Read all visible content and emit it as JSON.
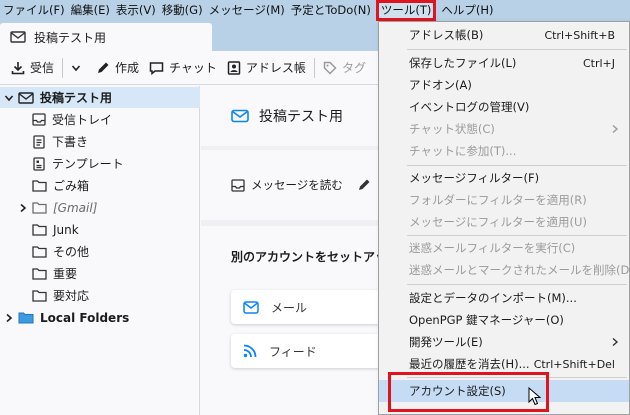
{
  "menubar": {
    "items": [
      "ファイル(F)",
      "編集(E)",
      "表示(V)",
      "移動(G)",
      "メッセージ(M)",
      "予定とToDo(N)",
      "ツール(T)",
      "ヘルプ(H)"
    ],
    "active": "ツール(T)"
  },
  "tab": {
    "title": "投稿テスト用"
  },
  "toolbar": {
    "receive": "受信",
    "compose": "作成",
    "chat": "チャット",
    "addressbook": "アドレス帳",
    "tag": "タグ"
  },
  "folders": {
    "account": "投稿テスト用",
    "items": [
      "受信トレイ",
      "下書き",
      "テンプレート",
      "ごみ箱",
      "[Gmail]",
      "Junk",
      "その他",
      "重要",
      "要対応"
    ],
    "local": "Local Folders"
  },
  "main": {
    "account_title": "投稿テスト用",
    "read_messages": "メッセージを読む",
    "setup_title": "別のアカウントをセットアップ",
    "mail": "メール",
    "feed": "フィード"
  },
  "menu": {
    "items": [
      {
        "label": "アドレス帳(B)",
        "shortcut": "Ctrl+Shift+B"
      },
      {
        "label": "保存したファイル(L)",
        "shortcut": "Ctrl+J"
      },
      {
        "label": "アドオン(A)",
        "shortcut": ""
      },
      {
        "label": "イベントログの管理(V)",
        "shortcut": ""
      },
      {
        "label": "チャット状態(C)",
        "shortcut": ""
      },
      {
        "label": "チャットに参加(T)...",
        "shortcut": ""
      },
      {
        "label": "メッセージフィルター(F)",
        "shortcut": ""
      },
      {
        "label": "フォルダーにフィルターを適用(R)",
        "shortcut": ""
      },
      {
        "label": "メッセージにフィルターを適用(U)",
        "shortcut": ""
      },
      {
        "label": "迷惑メールフィルターを実行(C)",
        "shortcut": ""
      },
      {
        "label": "迷惑メールとマークされたメールを削除(D)",
        "shortcut": ""
      },
      {
        "label": "設定とデータのインポート(M)...",
        "shortcut": ""
      },
      {
        "label": "OpenPGP 鍵マネージャー(O)",
        "shortcut": ""
      },
      {
        "label": "開発ツール(E)",
        "shortcut": ""
      },
      {
        "label": "最近の履歴を消去(H)...",
        "shortcut": "Ctrl+Shift+Del"
      },
      {
        "label": "アカウント設定(S)",
        "shortcut": ""
      }
    ]
  },
  "colors": {
    "menubar_bg": "#b8d1e6",
    "highlight_red": "#e0141e",
    "accent": "#0a84ff",
    "selection": "#d6e7f7"
  }
}
